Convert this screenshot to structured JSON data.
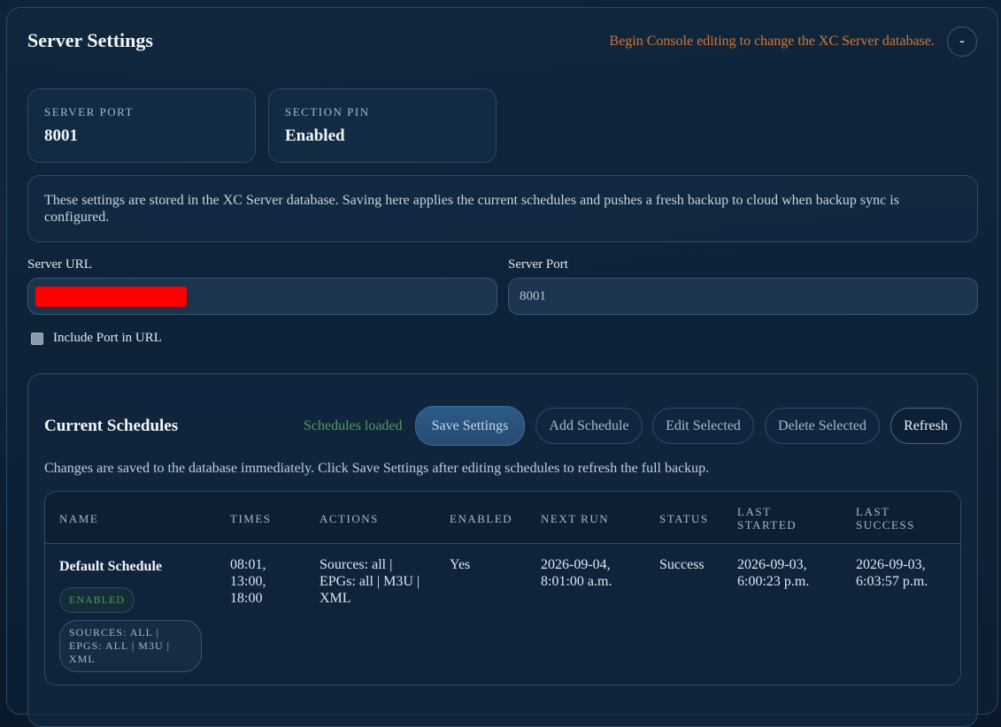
{
  "header": {
    "title": "Server Settings",
    "console_note": "Begin Console editing to change the XC Server database.",
    "collapse_label": "-"
  },
  "stats": [
    {
      "label": "SERVER PORT",
      "value": "8001"
    },
    {
      "label": "SECTION PIN",
      "value": "Enabled"
    }
  ],
  "info_text": "These settings are stored in the XC Server database. Saving here applies the current schedules and pushes a fresh backup to cloud when backup sync is configured.",
  "form": {
    "server_url_label": "Server URL",
    "server_url_value": "",
    "server_port_label": "Server Port",
    "server_port_value": "8001",
    "include_port_label": "Include Port in URL",
    "include_port_checked": false
  },
  "schedules": {
    "title": "Current Schedules",
    "status": "Schedules loaded",
    "buttons": {
      "save": "Save Settings",
      "add": "Add Schedule",
      "edit": "Edit Selected",
      "delete": "Delete Selected",
      "refresh": "Refresh"
    },
    "description": "Changes are saved to the database immediately. Click Save Settings after editing schedules to refresh the full backup.",
    "columns": [
      "NAME",
      "TIMES",
      "ACTIONS",
      "ENABLED",
      "NEXT RUN",
      "STATUS",
      "LAST STARTED",
      "LAST SUCCESS"
    ],
    "rows": [
      {
        "name": "Default Schedule",
        "badge_enabled": "ENABLED",
        "badge_sources": "SOURCES: ALL | EPGS: ALL | M3U | XML",
        "times": "08:01, 13:00, 18:00",
        "actions": "Sources: all | EPGs: all | M3U | XML",
        "enabled": "Yes",
        "next_run": "2026-09-04, 8:01:00 a.m.",
        "status": "Success",
        "last_started": "2026-09-03, 6:00:23 p.m.",
        "last_success": "2026-09-03, 6:03:57 p.m."
      }
    ]
  },
  "colors": {
    "accent_orange": "#d2783a",
    "success_green": "#4f9a63",
    "primary_button": "#2d5a87",
    "redaction": "#ff0000"
  }
}
